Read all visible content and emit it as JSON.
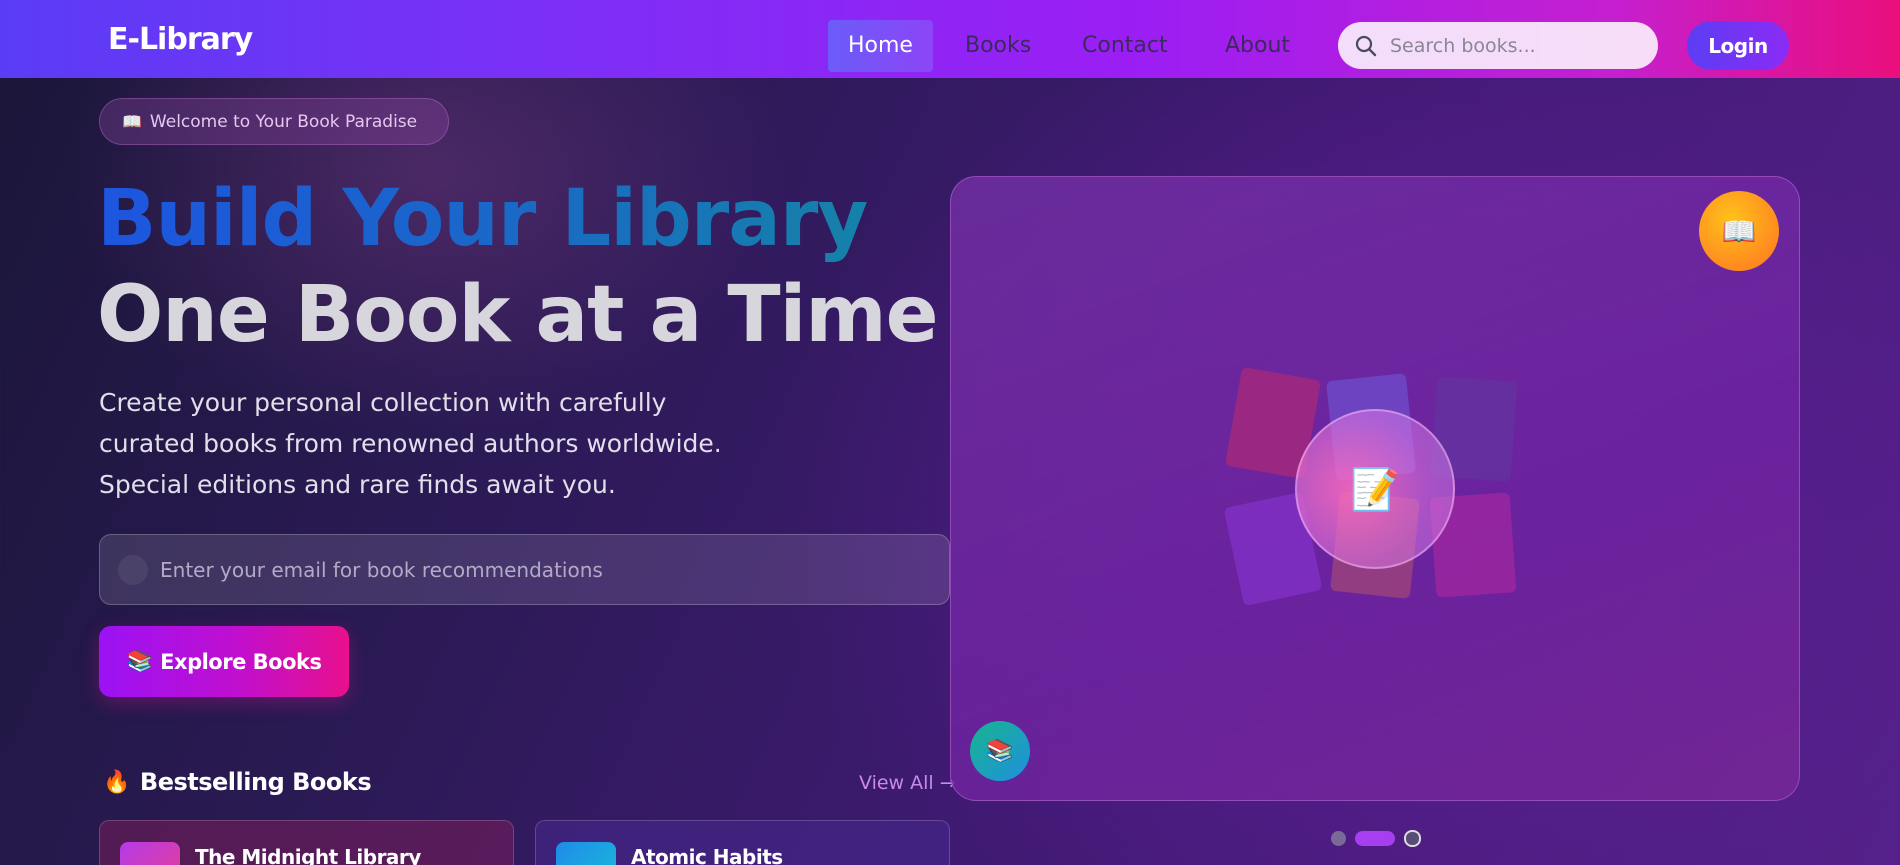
{
  "navbar": {
    "logo": "E-Library",
    "nav_items": [
      "Home",
      "Books",
      "Contact",
      "About"
    ],
    "active_item": "Home",
    "search_placeholder": "Search books...",
    "login_label": "Login"
  },
  "hero": {
    "badge": "Welcome to Your Book Paradise",
    "title_line1": "Build Your Library",
    "title_line2": "One Book at a Time",
    "description": "Create your personal collection with carefully curated books from renowned authors worldwide. Special editions and rare finds await you.",
    "email_placeholder": "Enter your email for book recommendations",
    "explore_label": "Explore Books"
  },
  "bestselling": {
    "title": "Bestselling Books",
    "view_all": "View All →",
    "books": [
      "The Midnight Library",
      "Atomic Habits"
    ]
  },
  "showcase": {
    "center_icon": "📝",
    "top_badge_icon": "📖",
    "bottom_badge_icon": "📚",
    "carousel_dots": 3,
    "active_dot": 2
  },
  "colors": {
    "nav_gradient_start": "#5b3cf6",
    "nav_gradient_end": "#ea0f7c",
    "accent_purple": "#9b12f4",
    "accent_pink": "#e8108c"
  }
}
